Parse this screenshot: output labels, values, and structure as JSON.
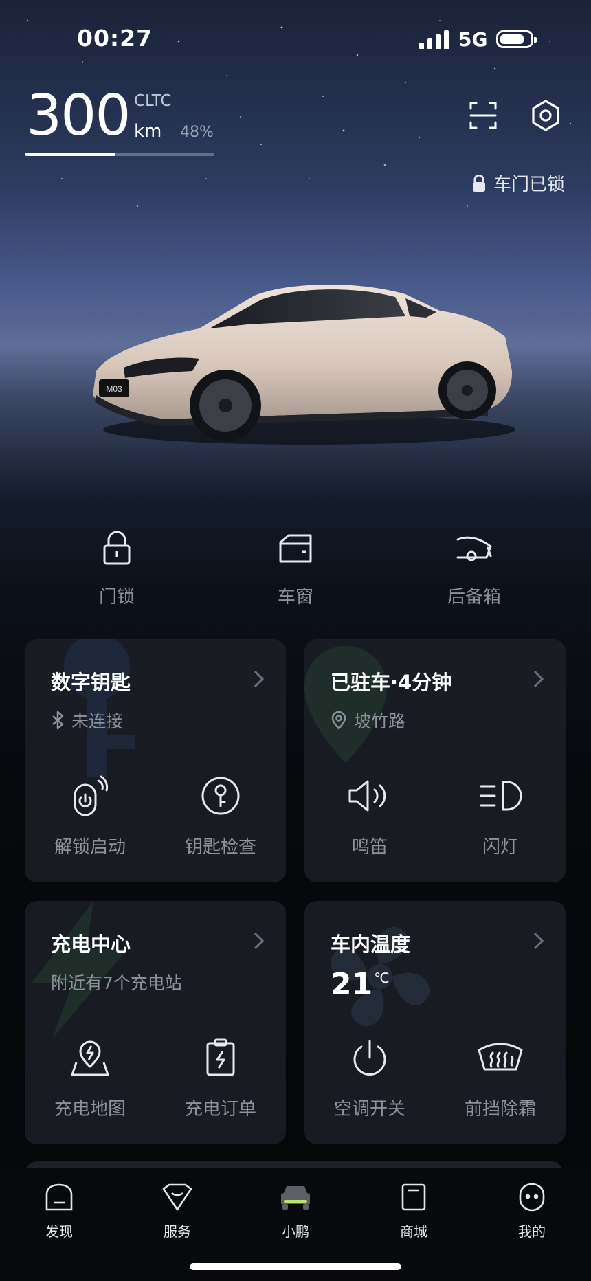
{
  "status_bar": {
    "time": "00:27",
    "network": "5G"
  },
  "range": {
    "value": "300",
    "standard": "CLTC",
    "unit": "km",
    "battery_percent": "48%",
    "battery_fraction": 0.48
  },
  "lock_status": "车门已锁",
  "quick_controls": [
    {
      "label": "门锁",
      "icon": "padlock-icon"
    },
    {
      "label": "车窗",
      "icon": "car-window-icon"
    },
    {
      "label": "后备箱",
      "icon": "trunk-icon"
    }
  ],
  "cards": {
    "digital_key": {
      "title": "数字钥匙",
      "status": "未连接",
      "actions": [
        {
          "label": "解锁启动",
          "icon": "remote-start-icon"
        },
        {
          "label": "钥匙检查",
          "icon": "key-check-icon"
        }
      ]
    },
    "parking": {
      "title": "已驻车·4分钟",
      "location": "坡竹路",
      "actions": [
        {
          "label": "鸣笛",
          "icon": "horn-speaker-icon"
        },
        {
          "label": "闪灯",
          "icon": "headlight-icon"
        }
      ]
    },
    "charging": {
      "title": "充电中心",
      "subtitle": "附近有7个充电站",
      "actions": [
        {
          "label": "充电地图",
          "icon": "charge-map-icon"
        },
        {
          "label": "充电订单",
          "icon": "charge-order-icon"
        }
      ]
    },
    "climate": {
      "title": "车内温度",
      "temperature": "21",
      "temperature_unit": "℃",
      "actions": [
        {
          "label": "空调开关",
          "icon": "power-icon"
        },
        {
          "label": "前挡除霜",
          "icon": "defrost-icon"
        }
      ]
    }
  },
  "car_plate": "M03",
  "tabs": [
    {
      "label": "发现",
      "icon": "discover-icon"
    },
    {
      "label": "服务",
      "icon": "service-icon"
    },
    {
      "label": "小鹏",
      "icon": "car-icon",
      "active": true
    },
    {
      "label": "商城",
      "icon": "store-icon"
    },
    {
      "label": "我的",
      "icon": "profile-icon"
    }
  ],
  "colors": {
    "accent": "#b7e36a",
    "card_bg": "#1e2128",
    "label_gray": "#8d929c"
  }
}
